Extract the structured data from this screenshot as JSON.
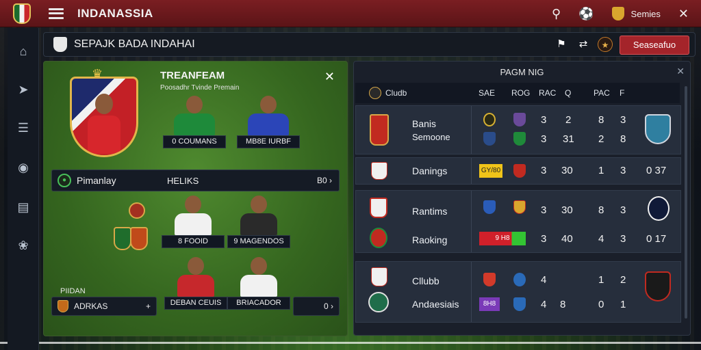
{
  "topbar": {
    "title": "INDANASSIA",
    "series_label": "Semies"
  },
  "subbar": {
    "title": "SEPAJK BADA INDAHAI",
    "action_button": "Seaseafuo"
  },
  "left_panel": {
    "title": "TREANFEAM",
    "subtitle": "Poosadhr Tvinde Premain",
    "featured_cards": [
      {
        "label": "0 COUMANS"
      },
      {
        "label": "MB8E IURBF"
      }
    ],
    "position_row": {
      "name": "Pimanlay",
      "value": "HELIKS",
      "action": "B0"
    },
    "mid_cards": [
      {
        "label": "8  FOOID"
      },
      {
        "label": "9  MAGENDOS"
      }
    ],
    "section_label": "PIIDAN",
    "bottom_cards": [
      {
        "label": "DEBAN CEUIS"
      },
      {
        "label": "BRIACADOR"
      }
    ],
    "bottom_left": {
      "name": "ADRKAS",
      "mark": "+"
    },
    "bottom_right": {
      "number": "0"
    }
  },
  "right_panel": {
    "title": "PAGM NIG",
    "header": {
      "club": "Cludb",
      "cols": [
        "SAE",
        "ROG",
        "RAC",
        "Q",
        "PAC",
        "F"
      ]
    },
    "rows": [
      {
        "teams": [
          "Banis",
          "Semoone"
        ],
        "lines": [
          [
            "3",
            "2",
            "8",
            "3"
          ],
          [
            "3",
            "31",
            "2",
            "8"
          ]
        ]
      },
      {
        "teams": [
          "Danings"
        ],
        "tag": "GY/80",
        "lines": [
          [
            "3",
            "30",
            "1",
            "3",
            "0 37"
          ]
        ]
      },
      {
        "teams": [
          "Rantims",
          "Raoking"
        ],
        "tag": "9 H8",
        "lines": [
          [
            "3",
            "30",
            "8",
            "3"
          ],
          [
            "3",
            "40",
            "4",
            "3",
            "0 17"
          ]
        ]
      },
      {
        "teams": [
          "Cllubb",
          "Andaesiais"
        ],
        "tag": "8H8",
        "lines": [
          [
            "4",
            "",
            "1",
            "2"
          ],
          [
            "4",
            "8",
            "0",
            "1"
          ]
        ]
      }
    ]
  },
  "colors": {
    "brand": "#7a1e22",
    "accent_red": "#a4242a",
    "panel_green": "#3b6b22",
    "panel_dark": "#1a1f2a"
  }
}
